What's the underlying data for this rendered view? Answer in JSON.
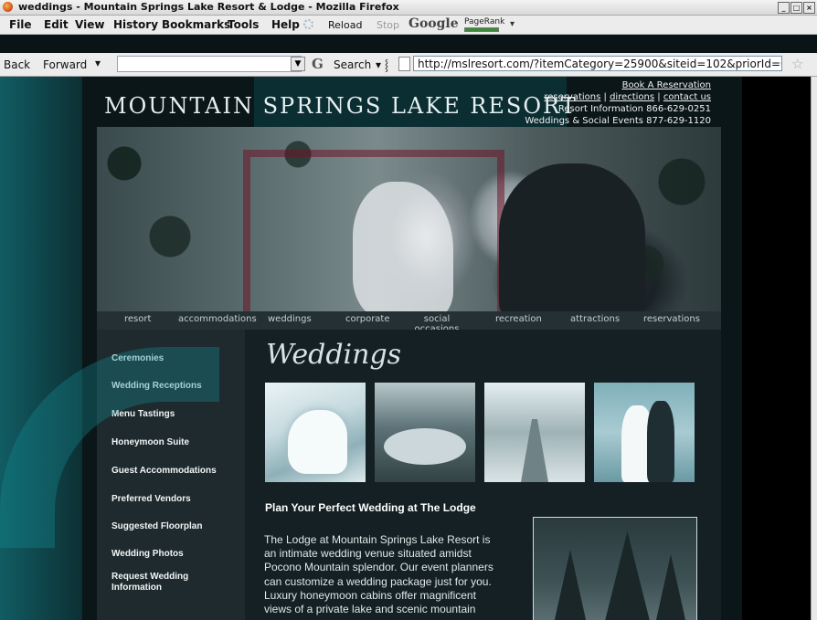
{
  "window": {
    "title": "weddings - Mountain Springs Lake Resort & Lodge - Mozilla Firefox"
  },
  "menu": {
    "file": "File",
    "edit": "Edit",
    "view": "View",
    "history": "History",
    "bookmarks": "Bookmarks",
    "tools": "Tools",
    "help": "Help",
    "reload": "Reload",
    "stop": "Stop",
    "google": "Google",
    "pagerank": "PageRank"
  },
  "toolbar": {
    "back": "Back",
    "forward": "Forward",
    "search_label": "Search",
    "url": "http://mslresort.com/?itemCategory=25900&siteid=102&priorId=0"
  },
  "site": {
    "brand": "Mountain Springs Lake Resort",
    "book_link": "Book A Reservation",
    "links": [
      "reservations",
      "directions",
      "contact us"
    ],
    "resort_info": "Resort Information 866-629-0251",
    "events_info": "Weddings & Social Events 877-629-1120"
  },
  "nav": [
    "resort",
    "accommodations",
    "weddings",
    "corporate",
    "social occasions",
    "recreation",
    "attractions",
    "reservations"
  ],
  "sidebar": [
    "Ceremonies",
    "Wedding Receptions",
    "Menu Tastings",
    "Honeymoon Suite",
    "Guest Accommodations",
    "Preferred Vendors",
    "Suggested Floorplan",
    "Wedding Photos",
    "Request Wedding Information"
  ],
  "content": {
    "script_title": "Weddings",
    "heading": "Plan Your Perfect Wedding at The Lodge",
    "body": "The Lodge at Mountain Springs Lake Resort is an intimate wedding venue situated amidst Pocono Mountain splendor. Our event planners can customize a wedding package just for you. Luxury honeymoon cabins offer magnificent views of a private lake and scenic mountain"
  }
}
